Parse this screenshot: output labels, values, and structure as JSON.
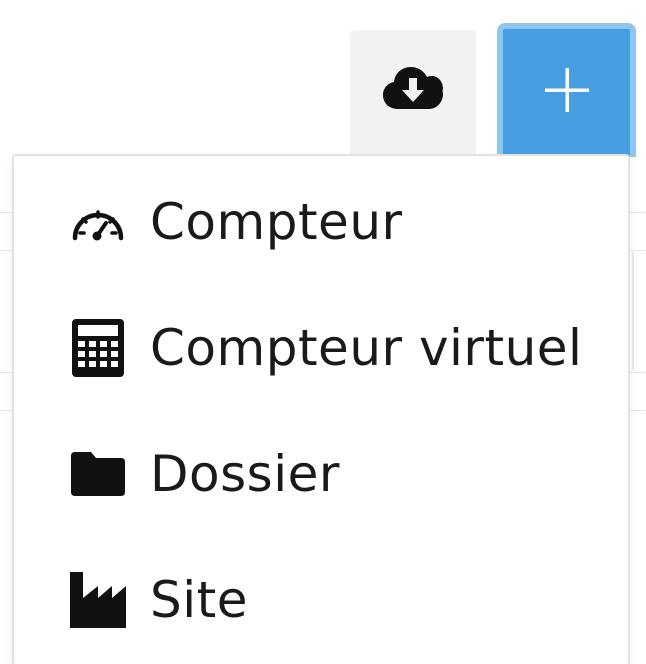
{
  "toolbar": {
    "download_icon": "cloud-download-icon",
    "add_icon": "plus-icon",
    "add_button_color": "#469ee0",
    "add_button_border_color": "#8ec6ef",
    "download_button_color": "#f2f2f2"
  },
  "menu": {
    "items": [
      {
        "label": "Compteur",
        "icon": "gauge-icon"
      },
      {
        "label": "Compteur virtuel",
        "icon": "calculator-icon"
      },
      {
        "label": "Dossier",
        "icon": "folder-icon"
      },
      {
        "label": "Site",
        "icon": "factory-icon"
      }
    ]
  }
}
